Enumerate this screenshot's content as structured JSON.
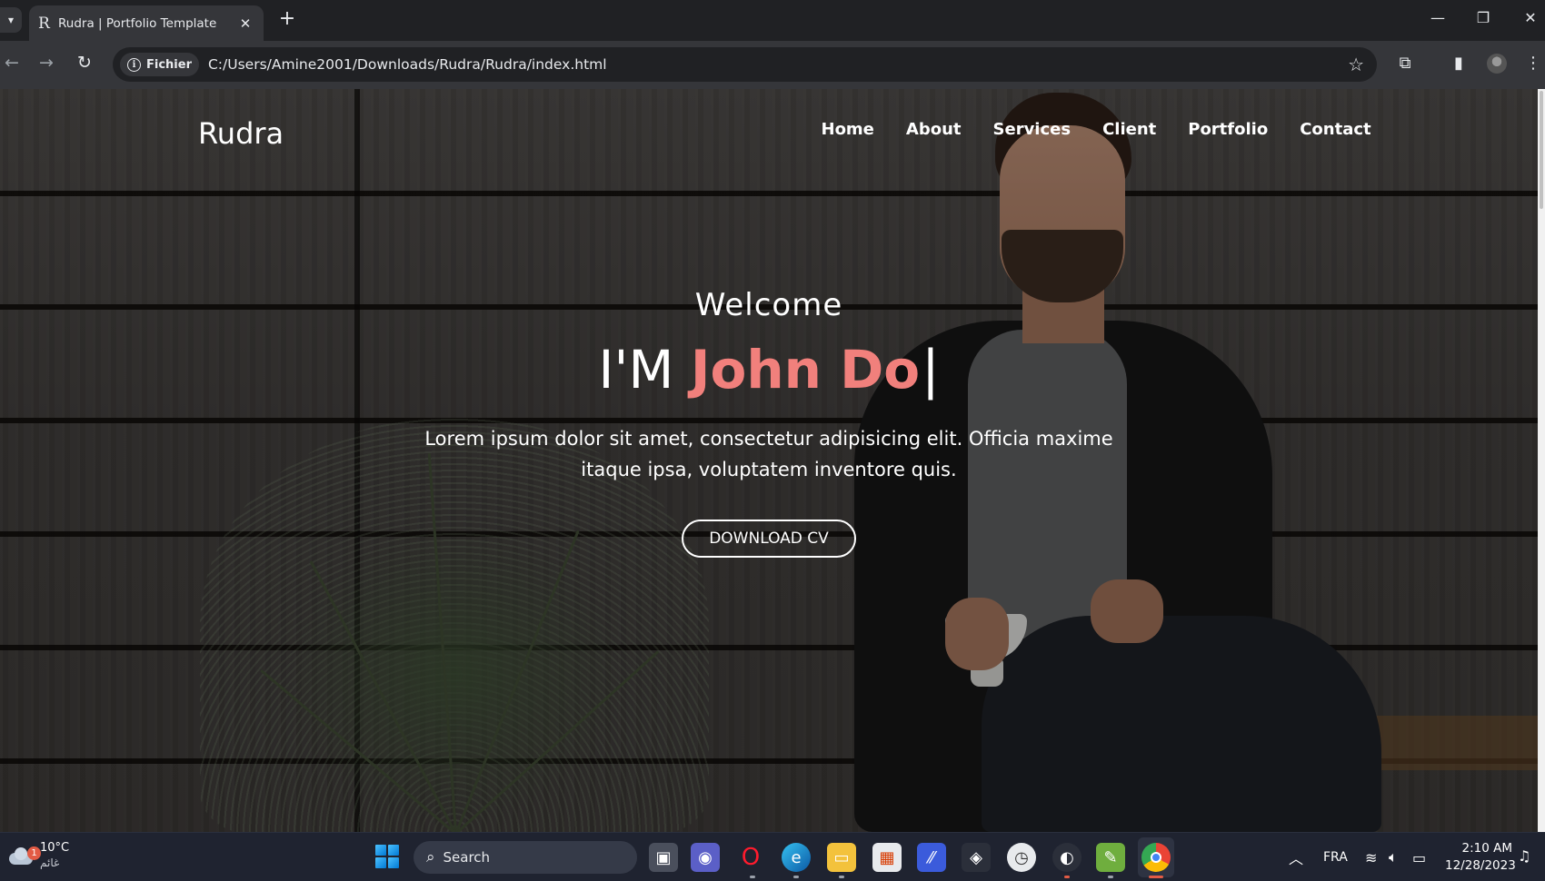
{
  "browser": {
    "tab_title": "Rudra | Portfolio Template",
    "tab_favicon": "R",
    "new_tab_icon": "+",
    "close_tab_icon": "✕",
    "security_chip": "Fichier",
    "url": "C:/Users/Amine2001/Downloads/Rudra/Rudra/index.html"
  },
  "site": {
    "brand": "Rudra",
    "nav": [
      {
        "label": "Home"
      },
      {
        "label": "About"
      },
      {
        "label": "Services"
      },
      {
        "label": "Client"
      },
      {
        "label": "Portfolio"
      },
      {
        "label": "Contact"
      }
    ],
    "hero": {
      "welcome": "Welcome",
      "prefix": "I'M",
      "name": "John Do",
      "caret": "|",
      "lead": "Lorem ipsum dolor sit amet, consectetur adipisicing elit. Officia maxime itaque ipsa, voluptatem inventore quis.",
      "cta": "DOWNLOAD CV"
    },
    "accent_color": "#f1807c"
  },
  "taskbar": {
    "weather_temp": "10°C",
    "weather_desc": "غائم",
    "weather_badge": "1",
    "search_label": "Search",
    "language": "FRA",
    "time": "2:10 AM",
    "date": "12/28/2023"
  }
}
